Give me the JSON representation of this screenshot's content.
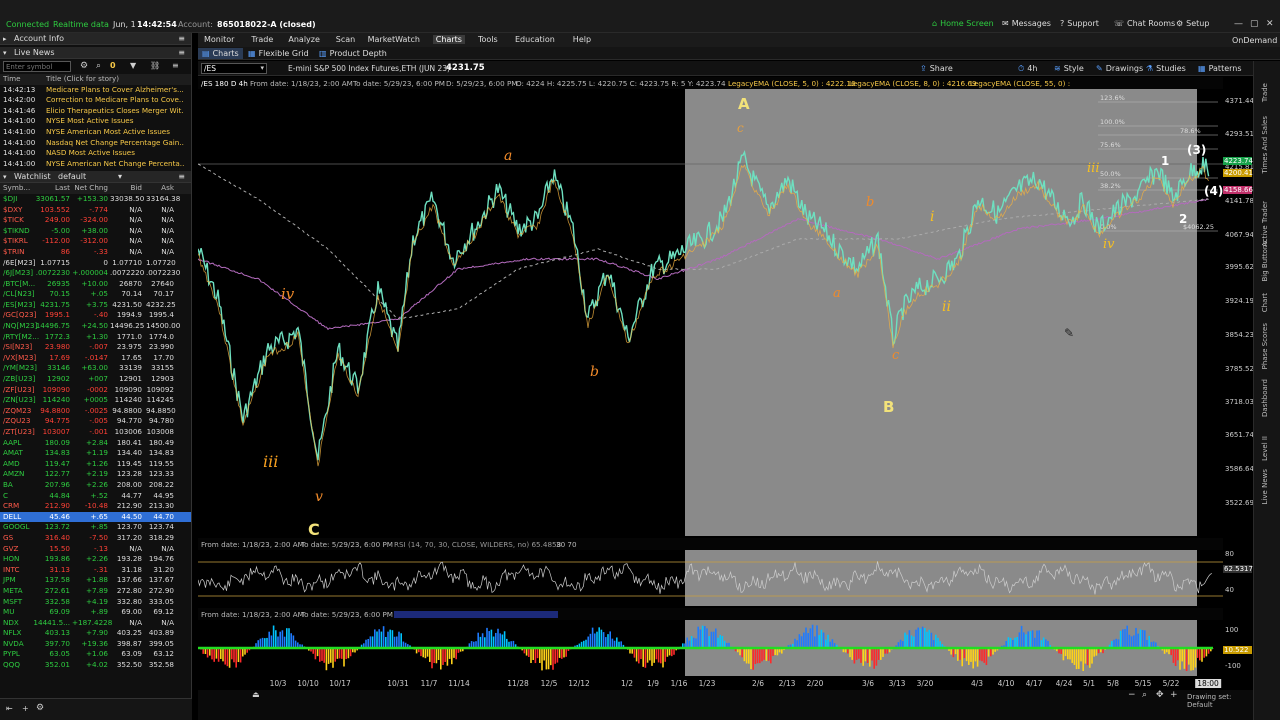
{
  "status": {
    "connected": "Connected",
    "realtime": "Realtime data",
    "date": "Jun, 1",
    "time": "14:42:54",
    "account_label": "Account:",
    "account": "865018022-A (closed)"
  },
  "top_links": [
    "Home Screen",
    "Messages",
    "Support",
    "Chat Rooms",
    "Setup"
  ],
  "ondemand": "OnDemand",
  "left": {
    "account_info": "Account Info",
    "live_news": "Live News",
    "symbol_placeholder": "Enter symbol",
    "symbol_count": "0",
    "news_headers": {
      "time": "Time",
      "title": "Title (Click for story)"
    },
    "news": [
      {
        "time": "14:42:13",
        "title": "Medicare Plans to Cover Alzheimer's..."
      },
      {
        "time": "14:42:00",
        "title": "Correction to Medicare Plans to Cove..."
      },
      {
        "time": "14:41:46",
        "title": "Elicio Therapeutics Closes Merger Wit..."
      },
      {
        "time": "14:41:00",
        "title": "NYSE Most Active Issues"
      },
      {
        "time": "14:41:00",
        "title": "NYSE American Most Active Issues"
      },
      {
        "time": "14:41:00",
        "title": "Nasdaq Net Change Percentage Gain..."
      },
      {
        "time": "14:41:00",
        "title": "NASD Most Active Issues"
      },
      {
        "time": "14:41:00",
        "title": "NYSE American Net Change Percenta..."
      }
    ],
    "watchlist_label": "Watchlist",
    "watchlist_name": "default",
    "wl_headers": {
      "sym": "Symb...",
      "last": "Last",
      "chg": "Net Chng",
      "bid": "Bid",
      "ask": "Ask"
    },
    "watchlist": [
      {
        "sym": "$DJI",
        "last": "33061.57",
        "chg": "+153.30",
        "bid": "33038.50",
        "ask": "33164.38",
        "dir": "up"
      },
      {
        "sym": "$DXY",
        "last": "103.552",
        "chg": "-.774",
        "bid": "N/A",
        "ask": "N/A",
        "dir": "down"
      },
      {
        "sym": "$TICK",
        "last": "249.00",
        "chg": "-324.00",
        "bid": "N/A",
        "ask": "N/A",
        "dir": "down"
      },
      {
        "sym": "$TIKND",
        "last": "-5.00",
        "chg": "+38.00",
        "bid": "N/A",
        "ask": "N/A",
        "dir": "up"
      },
      {
        "sym": "$TIKRL",
        "last": "-112.00",
        "chg": "-312.00",
        "bid": "N/A",
        "ask": "N/A",
        "dir": "down"
      },
      {
        "sym": "$TRIN",
        "last": "86",
        "chg": "-.33",
        "bid": "N/A",
        "ask": "N/A",
        "dir": "down"
      },
      {
        "sym": "/6E[M23]",
        "last": "1.07715",
        "chg": "0",
        "bid": "1.07710",
        "ask": "1.07720",
        "dir": "flat"
      },
      {
        "sym": "/6J[M23]",
        "last": ".0072230",
        "chg": "+.000004",
        "bid": ".0072220",
        "ask": ".0072230",
        "dir": "up"
      },
      {
        "sym": "/BTC[M...",
        "last": "26935",
        "chg": "+10.00",
        "bid": "26870",
        "ask": "27640",
        "dir": "up"
      },
      {
        "sym": "/CL[N23]",
        "last": "70.15",
        "chg": "+.05",
        "bid": "70.14",
        "ask": "70.17",
        "dir": "up"
      },
      {
        "sym": "/ES[M23]",
        "last": "4231.75",
        "chg": "+3.75",
        "bid": "4231.50",
        "ask": "4232.25",
        "dir": "up"
      },
      {
        "sym": "/GC[Q23]",
        "last": "1995.1",
        "chg": "-.40",
        "bid": "1994.9",
        "ask": "1995.4",
        "dir": "down"
      },
      {
        "sym": "/NQ[M23]",
        "last": "14496.75",
        "chg": "+24.50",
        "bid": "14496.25",
        "ask": "14500.00",
        "dir": "up"
      },
      {
        "sym": "/RTY[M2...",
        "last": "1772.3",
        "chg": "+1.30",
        "bid": "1771.0",
        "ask": "1774.0",
        "dir": "up"
      },
      {
        "sym": "/SI[N23]",
        "last": "23.980",
        "chg": "-.007",
        "bid": "23.975",
        "ask": "23.990",
        "dir": "down"
      },
      {
        "sym": "/VX[M23]",
        "last": "17.69",
        "chg": "-.0147",
        "bid": "17.65",
        "ask": "17.70",
        "dir": "down"
      },
      {
        "sym": "/YM[M23]",
        "last": "33146",
        "chg": "+63.00",
        "bid": "33139",
        "ask": "33155",
        "dir": "up"
      },
      {
        "sym": "/ZB[U23]",
        "last": "12902",
        "chg": "+007",
        "bid": "12901",
        "ask": "12903",
        "dir": "up"
      },
      {
        "sym": "/ZF[U23]",
        "last": "109090",
        "chg": "-0002",
        "bid": "109090",
        "ask": "109092",
        "dir": "down"
      },
      {
        "sym": "/ZN[U23]",
        "last": "114240",
        "chg": "+0005",
        "bid": "114240",
        "ask": "114245",
        "dir": "up"
      },
      {
        "sym": "/ZQM23",
        "last": "94.8800",
        "chg": "-.0025",
        "bid": "94.8800",
        "ask": "94.8850",
        "dir": "down"
      },
      {
        "sym": "/ZQU23",
        "last": "94.775",
        "chg": "-.005",
        "bid": "94.770",
        "ask": "94.780",
        "dir": "down"
      },
      {
        "sym": "/ZT[U23]",
        "last": "103007",
        "chg": "-.001",
        "bid": "103006",
        "ask": "103008",
        "dir": "down"
      },
      {
        "sym": "AAPL",
        "last": "180.09",
        "chg": "+2.84",
        "bid": "180.41",
        "ask": "180.49",
        "dir": "up"
      },
      {
        "sym": "AMAT",
        "last": "134.83",
        "chg": "+1.19",
        "bid": "134.40",
        "ask": "134.83",
        "dir": "up"
      },
      {
        "sym": "AMD",
        "last": "119.47",
        "chg": "+1.26",
        "bid": "119.45",
        "ask": "119.55",
        "dir": "up"
      },
      {
        "sym": "AMZN",
        "last": "122.77",
        "chg": "+2.19",
        "bid": "123.28",
        "ask": "123.33",
        "dir": "up"
      },
      {
        "sym": "BA",
        "last": "207.96",
        "chg": "+2.26",
        "bid": "208.00",
        "ask": "208.22",
        "dir": "up"
      },
      {
        "sym": "C",
        "last": "44.84",
        "chg": "+.52",
        "bid": "44.77",
        "ask": "44.95",
        "dir": "up"
      },
      {
        "sym": "CRM",
        "last": "212.90",
        "chg": "-10.48",
        "bid": "212.90",
        "ask": "213.30",
        "dir": "down"
      },
      {
        "sym": "DELL",
        "last": "45.46",
        "chg": "+.65",
        "bid": "44.50",
        "ask": "44.70",
        "dir": "up",
        "selected": true
      },
      {
        "sym": "GOOGL",
        "last": "123.72",
        "chg": "+.85",
        "bid": "123.70",
        "ask": "123.74",
        "dir": "up"
      },
      {
        "sym": "GS",
        "last": "316.40",
        "chg": "-7.50",
        "bid": "317.20",
        "ask": "318.29",
        "dir": "down"
      },
      {
        "sym": "GVZ",
        "last": "15.50",
        "chg": "-.13",
        "bid": "N/A",
        "ask": "N/A",
        "dir": "down"
      },
      {
        "sym": "HON",
        "last": "193.86",
        "chg": "+2.26",
        "bid": "193.28",
        "ask": "194.76",
        "dir": "up"
      },
      {
        "sym": "INTC",
        "last": "31.13",
        "chg": "-.31",
        "bid": "31.18",
        "ask": "31.20",
        "dir": "down"
      },
      {
        "sym": "JPM",
        "last": "137.58",
        "chg": "+1.88",
        "bid": "137.66",
        "ask": "137.67",
        "dir": "up"
      },
      {
        "sym": "META",
        "last": "272.61",
        "chg": "+7.89",
        "bid": "272.80",
        "ask": "272.90",
        "dir": "up"
      },
      {
        "sym": "MSFT",
        "last": "332.58",
        "chg": "+4.19",
        "bid": "332.80",
        "ask": "333.05",
        "dir": "up"
      },
      {
        "sym": "MU",
        "last": "69.09",
        "chg": "+.89",
        "bid": "69.00",
        "ask": "69.12",
        "dir": "up"
      },
      {
        "sym": "NDX",
        "last": "14441.5...",
        "chg": "+187.4228",
        "bid": "N/A",
        "ask": "N/A",
        "dir": "up"
      },
      {
        "sym": "NFLX",
        "last": "403.13",
        "chg": "+7.90",
        "bid": "403.25",
        "ask": "403.89",
        "dir": "up"
      },
      {
        "sym": "NVDA",
        "last": "397.70",
        "chg": "+19.36",
        "bid": "398.87",
        "ask": "399.05",
        "dir": "up"
      },
      {
        "sym": "PYPL",
        "last": "63.05",
        "chg": "+1.06",
        "bid": "63.09",
        "ask": "63.12",
        "dir": "up"
      },
      {
        "sym": "QQQ",
        "last": "352.01",
        "chg": "+4.02",
        "bid": "352.50",
        "ask": "352.58",
        "dir": "up"
      }
    ]
  },
  "menu": [
    "Monitor",
    "Trade",
    "Analyze",
    "Scan",
    "MarketWatch",
    "Charts",
    "Tools",
    "Education",
    "Help"
  ],
  "menu_active": "Charts",
  "subtabs": [
    "Charts",
    "Flexible Grid",
    "Product Depth"
  ],
  "toolbar": {
    "symbol": "/ES",
    "description": "E-mini S&P 500 Index Futures,ETH (JUN 23)",
    "price": "4231.75",
    "buttons": [
      "Share",
      "4h",
      "Style",
      "Drawings",
      "Studies",
      "Patterns"
    ]
  },
  "studies_line": {
    "timeframe": "/ES 180 D 4h",
    "from": "From date: 1/18/23, 2:00 AM",
    "to": "To date: 5/29/23, 6:00 PM",
    "dcur": "D: 5/29/23, 6:00 PM",
    "ohlc": "O: 4224   H: 4225.75   L: 4220.75   C: 4223.75   R: 5   Y: 4223.74",
    "ema1": "LegacyEMA (CLOSE, 5, 0) : 4222.16",
    "ema2": "LegacyEMA (CLOSE, 8, 0) : 4216.69",
    "ema3": "LegacyEMA (CLOSE, 55, 0) :"
  },
  "yaxis": [
    "4371.44",
    "4293.51",
    "4215.81",
    "4141.78",
    "4067.94",
    "3995.62",
    "3924.19",
    "3854.23",
    "3785.52",
    "3718.03",
    "3651.74",
    "3586.64",
    "3522.69"
  ],
  "y_badges": [
    {
      "label": "4223.74",
      "color": "#18a14a"
    },
    {
      "label": "4200.41",
      "color": "#c89b00"
    },
    {
      "label": "4158.66",
      "color": "#c0306a"
    }
  ],
  "fib_labels": [
    "123.6%",
    "100.0%",
    "78.6%",
    "75.6%",
    "50.0%",
    "38.2%",
    "0.0%",
    "$4062.25"
  ],
  "wave_labels": [
    "A",
    "c",
    "a",
    "b",
    "iv",
    "iii",
    "v",
    "C",
    "b",
    "a",
    "c",
    "B",
    "i",
    "ii",
    "iii",
    "iv",
    "1",
    "2",
    "(3)",
    "(4)"
  ],
  "rsi": {
    "from": "From date: 1/18/23, 2:00 AM",
    "to": "To date: 5/29/23, 6:00 PM",
    "desc": "RSI (14, 70, 30, CLOSE, WILDERS, no) 65.4858",
    "levels": "30   70",
    "axis": [
      "80",
      "40"
    ],
    "value": "62.5317"
  },
  "osc": {
    "from": "From date: 1/18/23, 2:00 AM",
    "to": "To date: 5/29/23, 6:00 PM",
    "axis": [
      "100",
      "-100"
    ],
    "value": "10.522"
  },
  "x_dates": [
    "10/3",
    "10/10",
    "10/17",
    "10/31",
    "11/7",
    "11/14",
    "11/28",
    "12/5",
    "12/12",
    "1/2",
    "1/9",
    "1/16",
    "1/23",
    "2/6",
    "2/13",
    "2/20",
    "3/6",
    "3/13",
    "3/20",
    "4/3",
    "4/10",
    "4/17",
    "4/24",
    "5/1",
    "5/8",
    "5/15",
    "5/22"
  ],
  "x_time": "18:00",
  "drawing_set": "Drawing set: Default",
  "side_tabs": [
    "Trade",
    "Times And Sales",
    "Active Trader",
    "Big Buttons",
    "Chart",
    "Phase Scores",
    "Dashboard",
    "Level II",
    "Live News"
  ]
}
